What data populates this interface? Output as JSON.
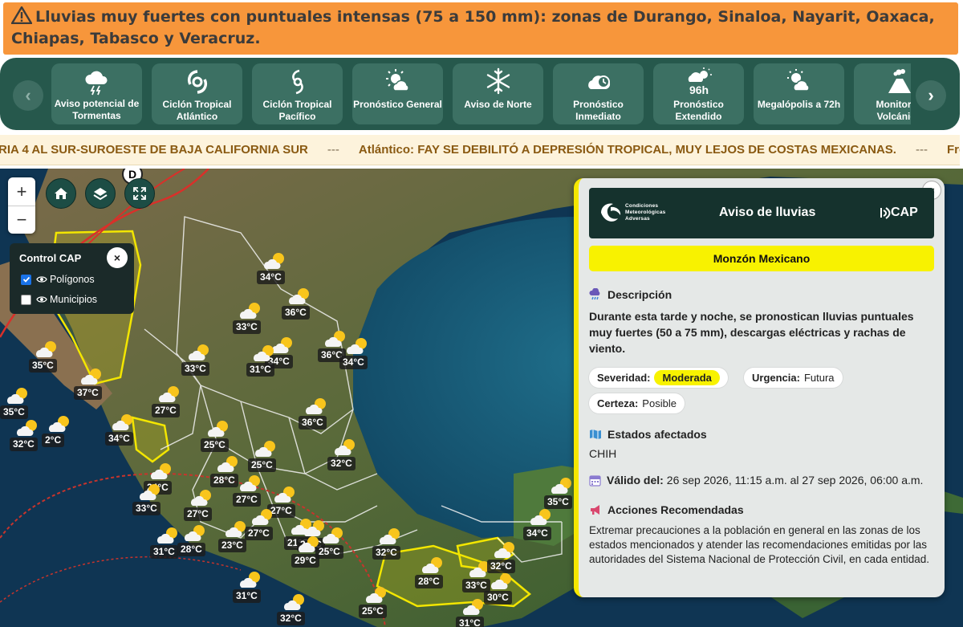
{
  "alert": {
    "text": "Lluvias muy fuertes con puntuales intensas (75 a 150 mm): zonas de Durango, Sinaloa, Nayarit, Oaxaca, Chiapas, Tabasco y Veracruz."
  },
  "nav": {
    "prev_label": "‹",
    "next_label": "›",
    "cards": [
      {
        "label": "Aviso potencial de Tormentas",
        "icon": "storm-cloud-icon"
      },
      {
        "label": "Ciclón Tropical Atlántico",
        "icon": "hurricane-icon"
      },
      {
        "label": "Ciclón Tropical Pacífico",
        "icon": "hurricane-icon"
      },
      {
        "label": "Pronóstico General",
        "icon": "sun-cloud-icon"
      },
      {
        "label": "Aviso de Norte",
        "icon": "snowflake-icon"
      },
      {
        "label": "Pronóstico Inmediato",
        "icon": "cloud-clock-icon"
      },
      {
        "label": "Pronóstico Extendido",
        "icon": "96h-icon",
        "badge": "96h"
      },
      {
        "label": "Megalópolis a 72h",
        "icon": "sun-cloud-icon"
      },
      {
        "label": "Monitoreo Volcánico",
        "icon": "volcano-icon"
      }
    ]
  },
  "ticker": {
    "items": [
      "RIA 4 AL SUR-SUROESTE DE BAJA CALIFORNIA SUR",
      "Atlántico: FAY SE DEBILITÓ A DEPRESIÓN TROPICAL, MUY LEJOS DE COSTAS MEXICANAS.",
      "Fre"
    ],
    "separator": "---"
  },
  "map": {
    "zoom_in": "+",
    "zoom_out": "−",
    "marker_letter": "D",
    "cap_control": {
      "title": "Control CAP",
      "close": "×",
      "layers": [
        {
          "label": "Polígonos",
          "checked": true
        },
        {
          "label": "Municipios",
          "checked": false
        }
      ]
    },
    "temperatures": [
      "34°C",
      "36°C",
      "33°C",
      "33°C",
      "34°C",
      "36°C",
      "34°C",
      "31°C",
      "35°C",
      "37°C",
      "27°C",
      "35°C",
      "32°C",
      "34°C",
      "36°C",
      "25°C",
      "25°C",
      "32°C",
      "24°C",
      "28°C",
      "27°C",
      "27°C",
      "33°C",
      "27°C",
      "27°C",
      "23°C",
      "21°C",
      "24°C",
      "25°C",
      "29°C",
      "31°C",
      "28°C",
      "32°C",
      "35°C",
      "34°C",
      "28°C",
      "33°C",
      "32°C",
      "30°C",
      "31°C",
      "32°C",
      "25°C",
      "31°C",
      "2°C"
    ]
  },
  "panel": {
    "close": "×",
    "org_name": [
      "Condiciones",
      "Meteorológicas",
      "Adversas"
    ],
    "title": "Aviso de lluvias",
    "brand": "CAP",
    "phenomenon": "Monzón Mexicano",
    "description_heading": "Descripción",
    "description": "Durante esta tarde y noche, se pronostican lluvias puntuales muy fuertes (50 a 75 mm), descargas eléctricas y rachas de viento.",
    "severity_label": "Severidad:",
    "severity_value": "Moderada",
    "urgency_label": "Urgencia:",
    "urgency_value": "Futura",
    "certainty_label": "Certeza:",
    "certainty_value": "Posible",
    "states_heading": "Estados afectados",
    "states": "CHIH",
    "valid_label": "Válido del:",
    "valid_value": "26 sep 2026, 11:15 a.m. al 27 sep 2026, 06:00 a.m.",
    "actions_heading": "Acciones Recomendadas",
    "actions": "Extremar precauciones a la población en general en las zonas de los estados mencionados y atender las recomendaciones emitidas por las autoridades del Sistema Nacional de Protección Civil, en cada entidad."
  },
  "colors": {
    "nav_bg": "#26584c",
    "alert_bg": "#f7963b",
    "severity_yellow": "#f8f200",
    "ticker_text": "#8a5a12"
  }
}
